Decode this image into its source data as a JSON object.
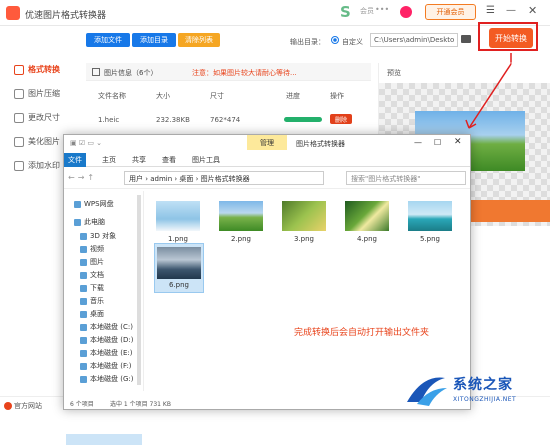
{
  "app": {
    "title": "优速图片格式转换器",
    "member_label": "会员",
    "vip_button": "开通会员"
  },
  "sidebar": {
    "items": [
      {
        "label": "格式转换",
        "active": true
      },
      {
        "label": "图片压缩"
      },
      {
        "label": "更改尺寸"
      },
      {
        "label": "美化图片"
      },
      {
        "label": "添加水印"
      }
    ]
  },
  "toolbar": {
    "add_file": "添加文件",
    "add_folder": "添加目录",
    "clear_list": "清除列表",
    "output_label": "输出目录：",
    "custom_label": "自定义",
    "output_path": "C:\\Users\\admin\\Deskto",
    "start_button": "开始转换"
  },
  "file_list": {
    "title": "图片信息（6个）",
    "note": "注意：如果图片较大请耐心等待...",
    "columns": [
      "文件名称",
      "大小",
      "尺寸",
      "进度",
      "操作"
    ],
    "row": {
      "name": "1.heic",
      "size": "232.38KB",
      "dimension": "762*474",
      "progress": 1.0,
      "action": "删除"
    }
  },
  "preview": {
    "title": "预览"
  },
  "footer": {
    "website": "官方网站"
  },
  "explorer": {
    "manage_tab": "管理",
    "title": "图片格式转换器",
    "tabs": [
      "文件",
      "主页",
      "共享",
      "查看",
      "图片工具"
    ],
    "address": "用户 › admin › 桌面 › 图片格式转换器",
    "search_placeholder": "搜索\"图片格式转换器\"",
    "nav": [
      {
        "label": "WPS网盘"
      },
      {
        "label": "此电脑"
      },
      {
        "label": "3D 对象"
      },
      {
        "label": "视频"
      },
      {
        "label": "图片"
      },
      {
        "label": "文档"
      },
      {
        "label": "下载"
      },
      {
        "label": "音乐"
      },
      {
        "label": "桌面"
      },
      {
        "label": "本地磁盘 (C:)"
      },
      {
        "label": "本地磁盘 (D:)"
      },
      {
        "label": "本地磁盘 (E:)"
      },
      {
        "label": "本地磁盘 (F:)"
      },
      {
        "label": "本地磁盘 (G:)"
      }
    ],
    "files": [
      "1.png",
      "2.png",
      "3.png",
      "4.png",
      "5.png",
      "6.png"
    ],
    "note": "完成转换后会自动打开输出文件夹",
    "status_count": "6 个项目",
    "status_selected": "选中 1 个项目 731 KB"
  },
  "watermark": {
    "name": "系统之家",
    "url": "XITONGZHIJIA.NET"
  },
  "colors": {
    "accent": "#f35b23",
    "highlight": "#e02020",
    "blue": "#1778e8"
  }
}
